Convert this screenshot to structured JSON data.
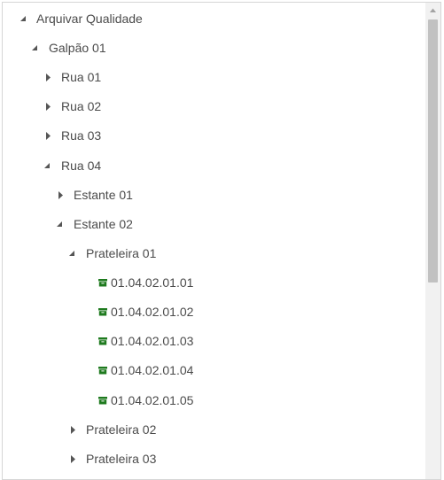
{
  "tree": {
    "root": {
      "label": "Arquivar Qualidade",
      "expanded": true
    },
    "warehouse": {
      "label": "Galpão 01",
      "expanded": true
    },
    "rua01": {
      "label": "Rua 01",
      "expanded": false
    },
    "rua02": {
      "label": "Rua 02",
      "expanded": false
    },
    "rua03": {
      "label": "Rua 03",
      "expanded": false
    },
    "rua04": {
      "label": "Rua 04",
      "expanded": true
    },
    "estante01": {
      "label": "Estante 01",
      "expanded": false
    },
    "estante02": {
      "label": "Estante 02",
      "expanded": true
    },
    "prateleira01": {
      "label": "Prateleira 01",
      "expanded": true
    },
    "boxes": [
      {
        "label": "01.04.02.01.01"
      },
      {
        "label": "01.04.02.01.02"
      },
      {
        "label": "01.04.02.01.03"
      },
      {
        "label": "01.04.02.01.04"
      },
      {
        "label": "01.04.02.01.05"
      }
    ],
    "prateleira02": {
      "label": "Prateleira 02",
      "expanded": false
    },
    "prateleira03": {
      "label": "Prateleira 03",
      "expanded": false
    }
  },
  "colors": {
    "box_icon": "#1e7a1e",
    "text": "#4b4b4b",
    "arrow": "#555555",
    "scroll_thumb": "#c1c1c1",
    "scroll_track": "#f1f1f1"
  },
  "icons": {
    "expanded": "triangle-down-right-icon",
    "collapsed": "triangle-right-icon",
    "box": "archive-box-icon",
    "scroll_up": "scroll-up-arrow-icon"
  }
}
